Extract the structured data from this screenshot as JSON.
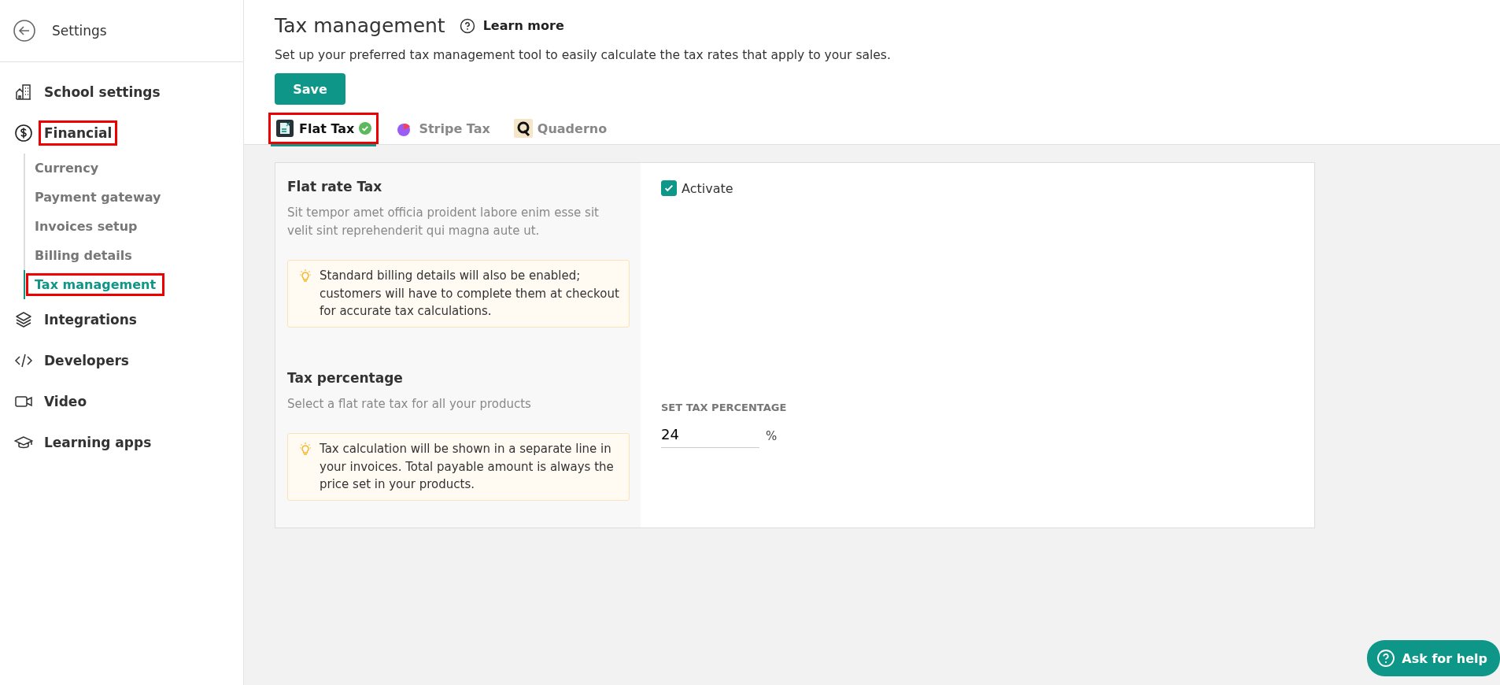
{
  "sidebar": {
    "back_label": "Settings",
    "items": [
      {
        "label": "School settings",
        "annotated": false
      },
      {
        "label": "Financial",
        "annotated": true,
        "children": [
          {
            "label": "Currency",
            "selected": false,
            "annotated": false
          },
          {
            "label": "Payment gateway",
            "selected": false,
            "annotated": false
          },
          {
            "label": "Invoices setup",
            "selected": false,
            "annotated": false
          },
          {
            "label": "Billing details",
            "selected": false,
            "annotated": false
          },
          {
            "label": "Tax management",
            "selected": true,
            "annotated": true
          }
        ]
      },
      {
        "label": "Integrations",
        "annotated": false
      },
      {
        "label": "Developers",
        "annotated": false
      },
      {
        "label": "Video",
        "annotated": false
      },
      {
        "label": "Learning apps",
        "annotated": false
      }
    ]
  },
  "header": {
    "title": "Tax management",
    "learn_more": "Learn more",
    "description": "Set up your preferred tax management tool to easily calculate the tax rates that apply to your sales.",
    "save": "Save"
  },
  "tabs": [
    {
      "kind": "flat",
      "label": "Flat Tax",
      "selected": true,
      "active_check": true,
      "annotated": true
    },
    {
      "kind": "stripe",
      "label": "Stripe Tax",
      "selected": false,
      "active_check": false,
      "annotated": false
    },
    {
      "kind": "quaderno",
      "label": "Quaderno",
      "selected": false,
      "active_check": false,
      "annotated": false
    }
  ],
  "sections": [
    {
      "title": "Flat rate Tax",
      "description": "Sit tempor amet officia proident labore enim esse sit velit sint reprehenderit qui magna aute ut.",
      "tip": "Standard billing details will also be enabled; customers will have to complete them at checkout for accurate tax calculations.",
      "kind": "checkbox",
      "label": "Activate",
      "checked": true
    },
    {
      "title": "Tax percentage",
      "description": "Select a flat rate tax for all your products",
      "tip": "Tax calculation will be shown in a separate line in your invoices. Total payable amount is always the price set in your products.",
      "kind": "input",
      "label": "SET TAX PERCENTAGE",
      "value": "24",
      "suffix": "%"
    }
  ],
  "help_button": "Ask for help"
}
